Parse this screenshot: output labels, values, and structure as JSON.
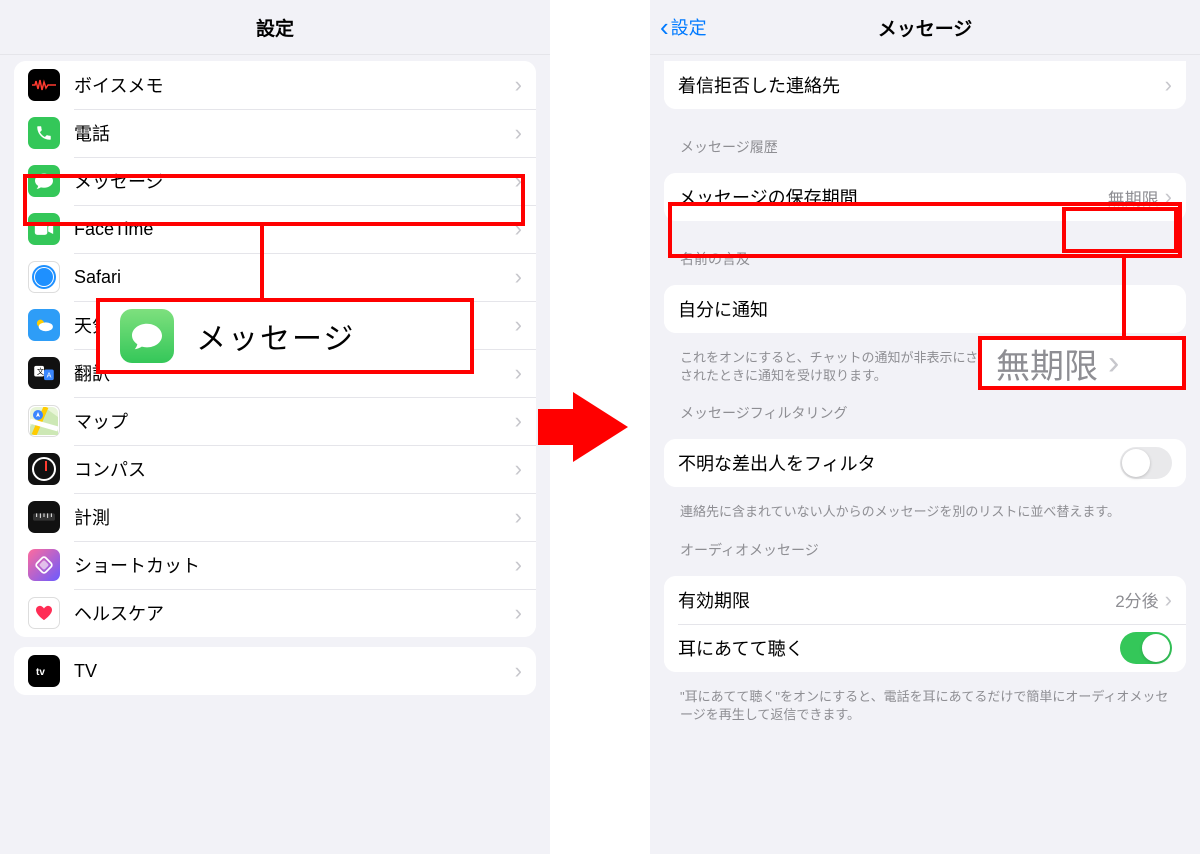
{
  "left": {
    "title": "設定",
    "items": [
      {
        "label": "ボイスメモ"
      },
      {
        "label": "電話"
      },
      {
        "label": "メッセージ"
      },
      {
        "label": "FaceTime"
      },
      {
        "label": "Safari"
      },
      {
        "label": "天気"
      },
      {
        "label": "翻訳"
      },
      {
        "label": "マップ"
      },
      {
        "label": "コンパス"
      },
      {
        "label": "計測"
      },
      {
        "label": "ショートカット"
      },
      {
        "label": "ヘルスケア"
      }
    ],
    "second_group": {
      "label": "TV"
    },
    "callout": "メッセージ"
  },
  "right": {
    "back": "設定",
    "title": "メッセージ",
    "blocked": {
      "label": "着信拒否した連絡先"
    },
    "history_header": "メッセージ履歴",
    "keep": {
      "label": "メッセージの保存期間",
      "value": "無期限"
    },
    "mention_header": "名前の言及",
    "notify_me": {
      "label": "自分に通知"
    },
    "notify_note": "これをオンにすると、チャットの通知が非表示にされている場合でも、名前が言及されたときに通知を受け取ります。",
    "filter_header": "メッセージフィルタリング",
    "filter": {
      "label": "不明な差出人をフィルタ"
    },
    "filter_note": "連絡先に含まれていない人からのメッセージを別のリストに並べ替えます。",
    "audio_header": "オーディオメッセージ",
    "expire": {
      "label": "有効期限",
      "value": "2分後"
    },
    "raise": {
      "label": "耳にあてて聴く"
    },
    "raise_note": "\"耳にあてて聴く\"をオンにすると、電話を耳にあてるだけで簡単にオーディオメッセージを再生して返信できます。",
    "callout_value": "無期限"
  }
}
